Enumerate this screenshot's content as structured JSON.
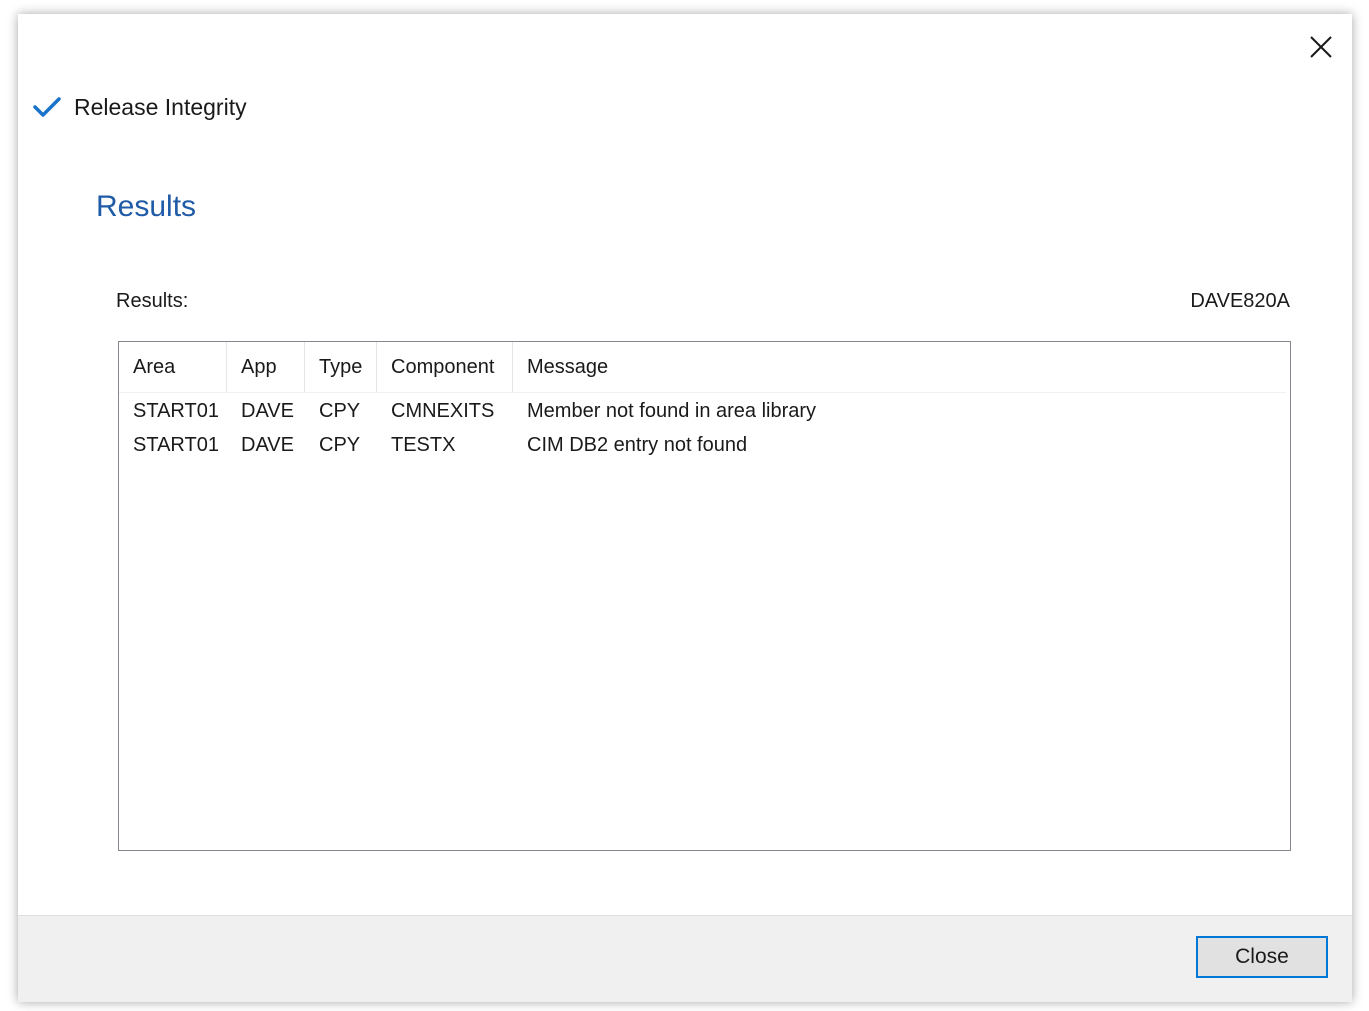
{
  "dialog": {
    "close_icon": "close-x-icon",
    "task_title": "Release Integrity",
    "task_icon": "checkmark-icon",
    "section_title": "Results",
    "results_label": "Results:",
    "package_id": "DAVE820A",
    "accent_color": "#1f5ba6",
    "check_color": "#1a73c9"
  },
  "table": {
    "columns": [
      "Area",
      "App",
      "Type",
      "Component",
      "Message"
    ],
    "rows": [
      {
        "area": "START01",
        "app": "DAVE",
        "type": "CPY",
        "component": "CMNEXITS",
        "message": "Member not found in area library"
      },
      {
        "area": "START01",
        "app": "DAVE",
        "type": "CPY",
        "component": "TESTX",
        "message": "CIM DB2 entry not found"
      }
    ]
  },
  "footer": {
    "close_label": "Close"
  }
}
